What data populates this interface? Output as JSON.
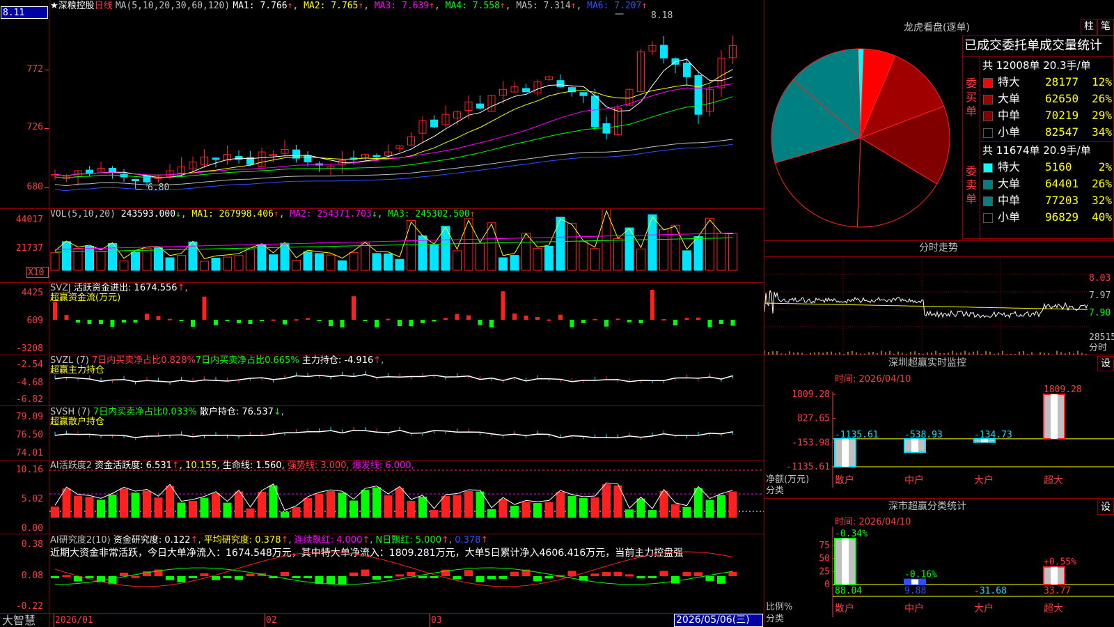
{
  "colors": {
    "up": "#ff2020",
    "down": "#00e5ff",
    "frame": "#8b0000",
    "label": "#ff3b3b",
    "yellow": "#ffff00",
    "magenta": "#ff00ff",
    "green": "#00ff00",
    "white": "#ffffff"
  },
  "top_left_value": "8.11",
  "brand": "大智慧",
  "main": {
    "star_title": "★深粮控股",
    "period": "日线",
    "ma_params": "MA(5,10,20,30,60,120)",
    "ma": [
      {
        "label": "MA1: 7.766",
        "arrow": "↑",
        "color": "#ffffff"
      },
      {
        "label": "MA2: 7.765",
        "arrow": "↑",
        "color": "#ffff00"
      },
      {
        "label": "MA3: 7.639",
        "arrow": "↑",
        "color": "#ff00ff"
      },
      {
        "label": "MA4: 7.558",
        "arrow": "↑",
        "color": "#00ff00"
      },
      {
        "label": "MA5: 7.314",
        "arrow": "↑",
        "color": "#c0c0c0"
      },
      {
        "label": "MA6: 7.207",
        "arrow": "↑",
        "color": "#3050ff"
      }
    ],
    "y_labels": [
      "772",
      "726",
      "680"
    ],
    "high_label": "8.18",
    "low_label": "6.80"
  },
  "vol": {
    "title": "VOL(5,10,20)",
    "value": "243593.000",
    "value_arrow": "↓",
    "ma1": "MA1: 267998.406",
    "ma1_arrow": "↑",
    "ma2": "MA2: 254371.703",
    "ma2_arrow": "↓",
    "ma3": "MA3: 245302.500",
    "ma3_arrow": "↑",
    "y_labels": [
      "44017",
      "21737"
    ],
    "unit": "X10"
  },
  "svzj": {
    "title": "SVZJ",
    "desc": "活跃资金进出: 1674.556",
    "arrow": "↑",
    "tail": ",",
    "subtitle": "超赢资金流(万元)",
    "y_labels": [
      "4425",
      "609",
      "-3208"
    ]
  },
  "svzl": {
    "title": "SVZL (7)",
    "a": "7日内买卖净占比0.828%",
    "b": "7日内买卖净占比0.665%",
    "c": "主力持仓: -4.916",
    "arrow": "↑",
    "tail": ",",
    "subtitle": "超赢主力持仓",
    "y_labels": [
      "-2.54",
      "-4.68",
      "-6.82"
    ]
  },
  "svsh": {
    "title": "SVSH (7)",
    "a": "7日内买卖净占比0.033%",
    "c": "散户持仓: 76.537",
    "arrow": "↓",
    "tail": ",",
    "subtitle": "超赢散户持仓",
    "y_labels": [
      "79.09",
      "76.50",
      "74.01"
    ]
  },
  "ai1": {
    "title": "AI活跃度2",
    "a": "资金活跃度: 6.531",
    "a_arrow": "↑",
    "b": ", 10.155,",
    "c": "生命线: 1.560,",
    "d": "强势线: 3.000,",
    "e": "爆发线: 6.000,",
    "y_labels": [
      "10.16",
      "5.02",
      "0.00"
    ]
  },
  "ai2": {
    "title": "AI研究度2(10)",
    "a": "资金研究度: 0.122",
    "a_arrow": "↑",
    "b": "平均研究度: 0.378",
    "b_arrow": "↑",
    "c": "连续飘红: 4.000",
    "c_arrow": "↑",
    "d": "N日飘红: 5.000",
    "d_arrow": "↑",
    "e": "0.378",
    "e_arrow": "↑",
    "comment": "近期大资金非常活跃，今日大单净流入：1674.548万元，其中特大单净流入：1809.281万元，大单5日累计净入4606.416万元，当前主力控盘强",
    "y_labels": [
      "0.38",
      "0.08",
      "-0.22"
    ]
  },
  "x_axis": {
    "labels": [
      "2026/01",
      "02",
      "03"
    ],
    "current": "2026/05/06(三)"
  },
  "lhb": {
    "title": "龙虎看盘(逐单)",
    "btn1": "柱",
    "btn2": "笔",
    "table_header": "已成交委托单成交量统计",
    "buy": {
      "side": "委买单",
      "summary": "共 12008单 20.3手/单",
      "rows": [
        {
          "name": "特大",
          "vol": "28177",
          "pct": "12%",
          "color": "#ff0000"
        },
        {
          "name": "大单",
          "vol": "62650",
          "pct": "26%",
          "color": "#a00000"
        },
        {
          "name": "中单",
          "vol": "70219",
          "pct": "29%",
          "color": "#800000"
        },
        {
          "name": "小单",
          "vol": "82547",
          "pct": "34%",
          "color": "#000000"
        }
      ]
    },
    "sell": {
      "side": "委卖单",
      "summary": "共 11674单 20.9手/单",
      "rows": [
        {
          "name": "特大",
          "vol": "5160",
          "pct": "2%",
          "color": "#00ffff"
        },
        {
          "name": "大单",
          "vol": "64401",
          "pct": "26%",
          "color": "#008080"
        },
        {
          "name": "中单",
          "vol": "77203",
          "pct": "32%",
          "color": "#008080"
        },
        {
          "name": "小单",
          "vol": "96829",
          "pct": "40%",
          "color": "#000000"
        }
      ]
    }
  },
  "intraday": {
    "title": "分时走势",
    "prices": [
      "8.03",
      "7.97",
      "7.90"
    ],
    "vol_label": "28515",
    "tag": "分时"
  },
  "monitor": {
    "title": "深圳超赢实时监控",
    "btn": "设",
    "time": "时间: 2026/04/10",
    "y_labels": [
      "1809.28",
      "827.65",
      "-153.98",
      "-1135.61"
    ],
    "axis_title1": "净额(万元)",
    "axis_title2": "分类",
    "bars": [
      {
        "name": "散户",
        "value": -1135.61,
        "label": "-1135.61"
      },
      {
        "name": "中户",
        "value": -538.93,
        "label": "-538.93"
      },
      {
        "name": "大户",
        "value": -134.73,
        "label": "-134.73"
      },
      {
        "name": "超大",
        "value": 1809.28,
        "label": "1809.28"
      }
    ]
  },
  "classify": {
    "title": "深市超赢分类统计",
    "btn": "设",
    "time": "时间: 2026/04/10",
    "y_labels": [
      "75",
      "50",
      "25",
      "0"
    ],
    "axis_title1": "比例%",
    "axis_title2": "分类",
    "bars": [
      {
        "name": "散户",
        "value": 88.04,
        "top": "-0.34%",
        "bottom": "88.04"
      },
      {
        "name": "中户",
        "value": 9.88,
        "top": "-0.16%",
        "bottom": "9.88"
      },
      {
        "name": "大户",
        "value": 0,
        "top": "",
        "bottom": "-31.68"
      },
      {
        "name": "超大",
        "value": 33.77,
        "top": "+0.55%",
        "bottom": "33.77"
      }
    ]
  }
}
